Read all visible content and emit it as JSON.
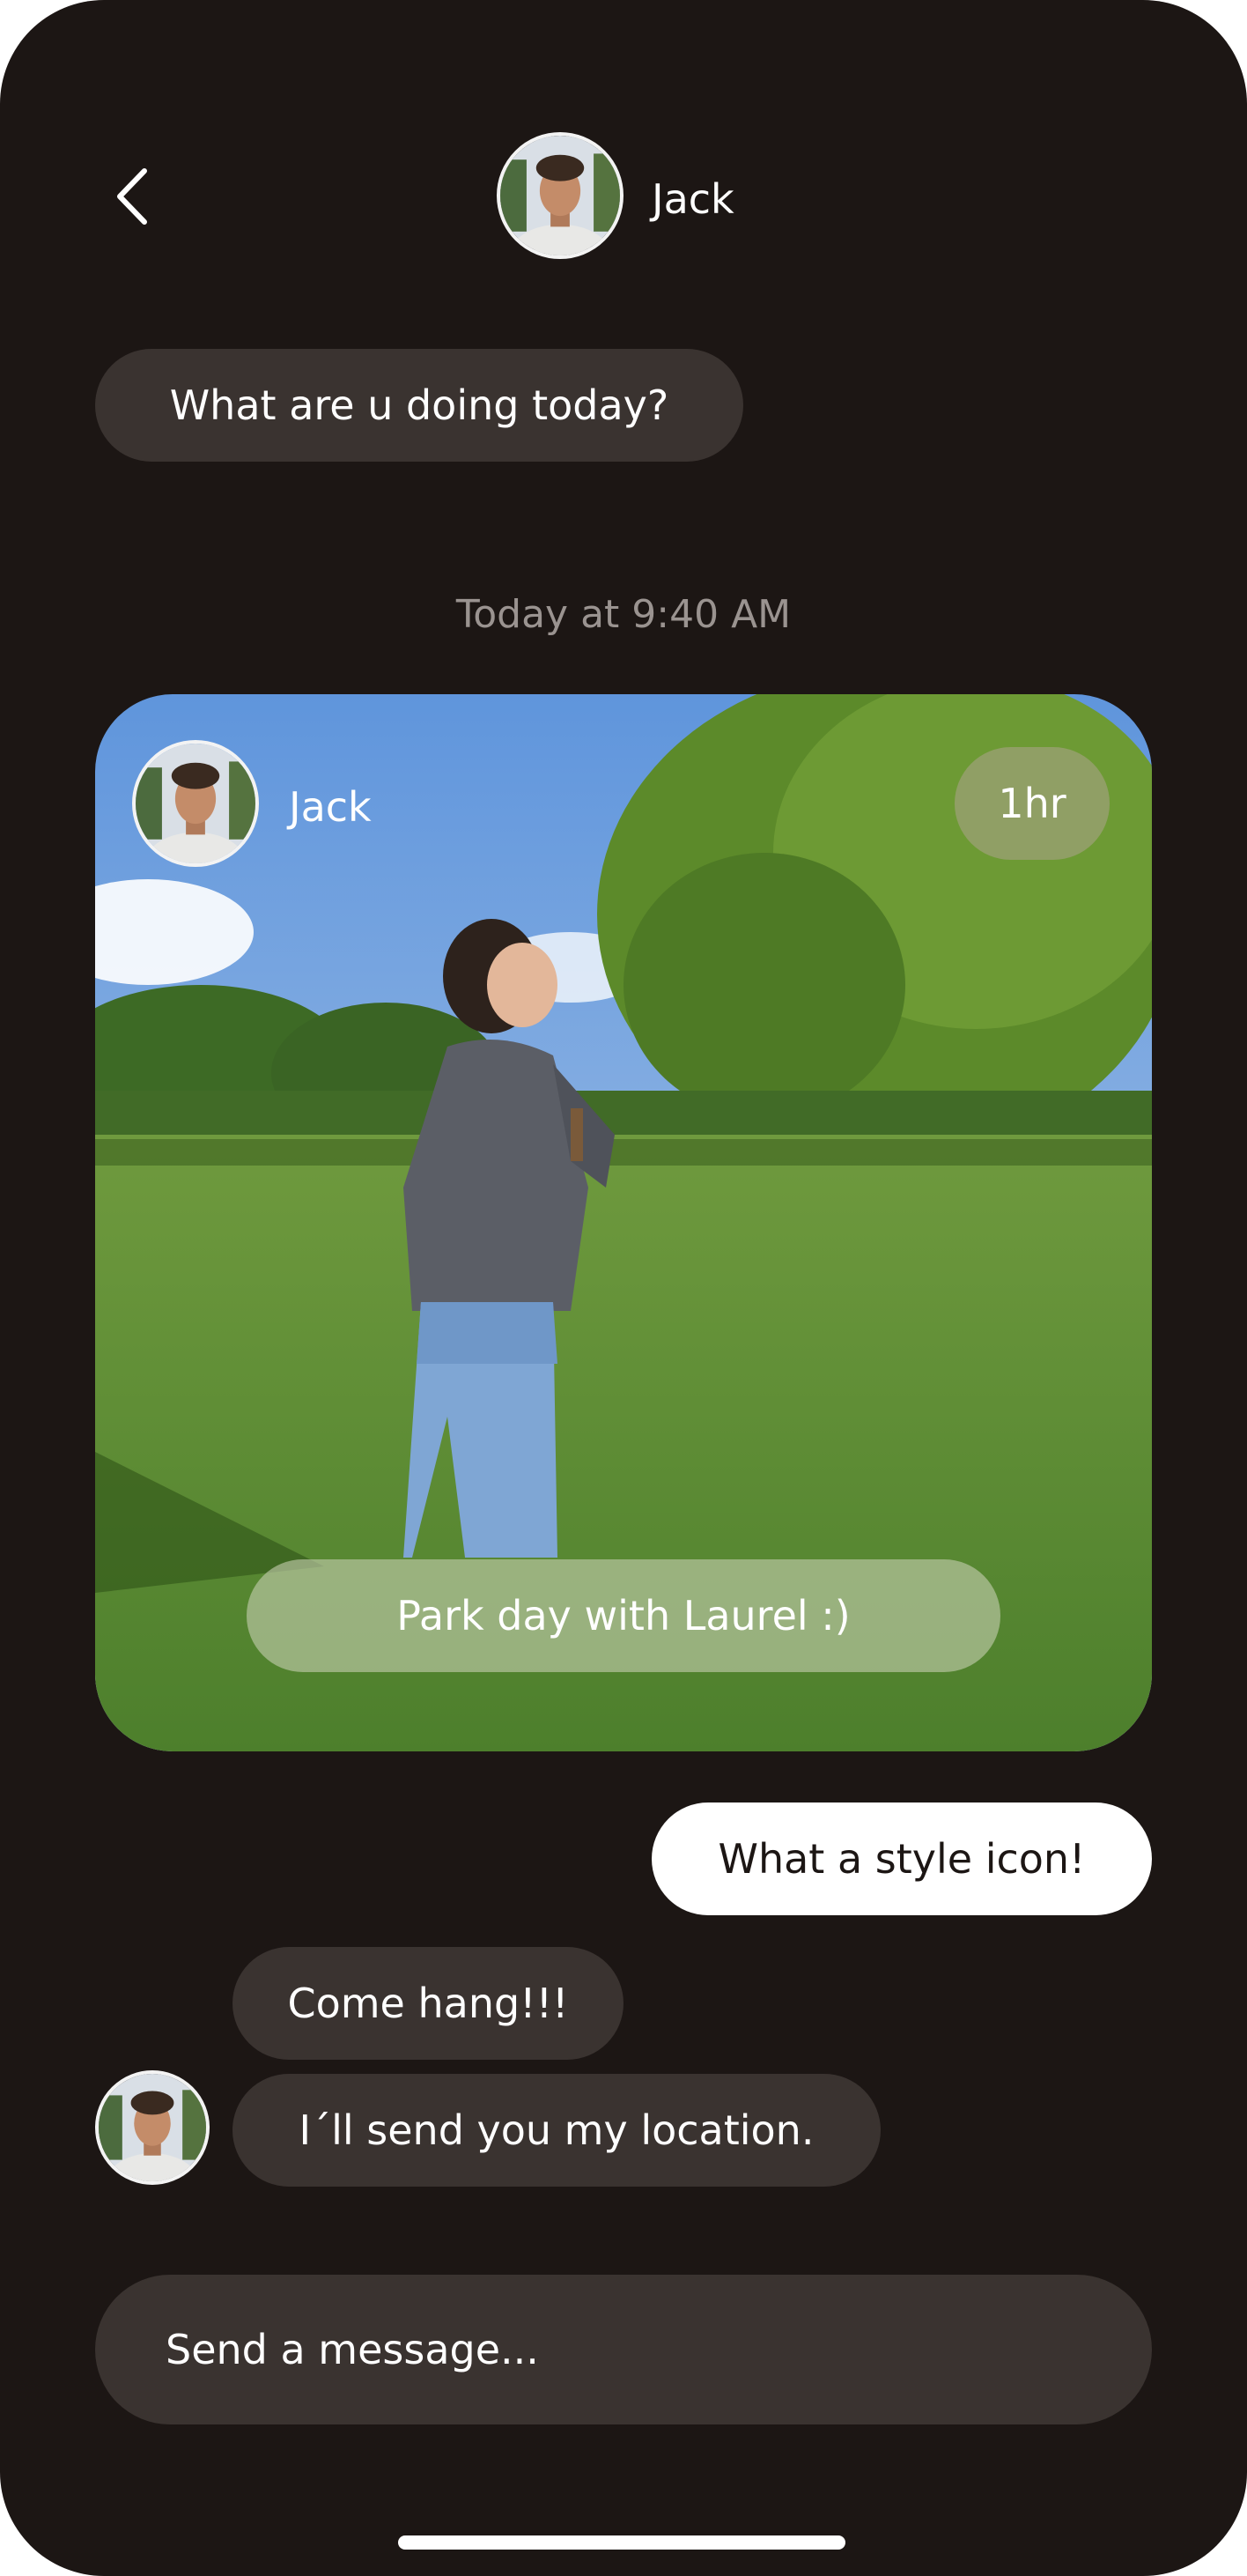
{
  "header": {
    "contact_name": "Jack",
    "back_icon": "chevron-left-icon"
  },
  "messages": {
    "first_incoming": "What are u doing today?",
    "timestamp": "Today at 9:40 AM",
    "photo_post": {
      "author": "Jack",
      "age_badge": "1hr",
      "caption": "Park day with Laurel :)"
    },
    "outgoing_reply": "What a style icon!",
    "incoming_1": "Come hang!!!",
    "incoming_2": "I´ll send you my location."
  },
  "composer": {
    "placeholder": "Send a message..."
  },
  "colors": {
    "background": "#1c1614",
    "incoming_bubble": "#3a3330",
    "outgoing_bubble": "#ffffff",
    "timestamp": "#9a9390"
  }
}
